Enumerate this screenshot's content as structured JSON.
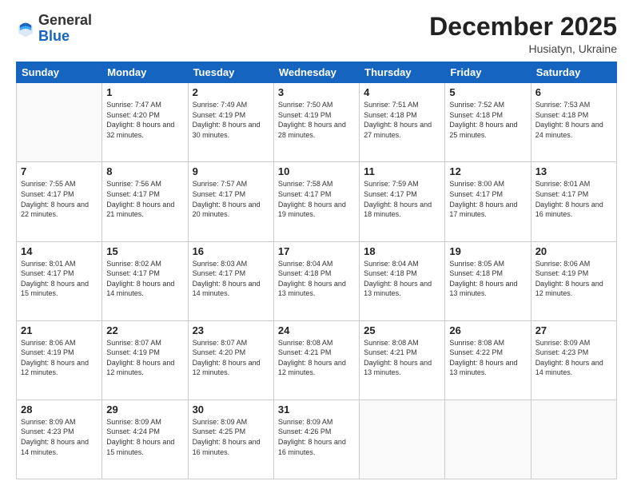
{
  "header": {
    "logo_general": "General",
    "logo_blue": "Blue",
    "month_title": "December 2025",
    "subtitle": "Husiatyn, Ukraine"
  },
  "weekdays": [
    "Sunday",
    "Monday",
    "Tuesday",
    "Wednesday",
    "Thursday",
    "Friday",
    "Saturday"
  ],
  "weeks": [
    [
      {
        "day": "",
        "empty": true
      },
      {
        "day": "1",
        "sunrise": "7:47 AM",
        "sunset": "4:20 PM",
        "daylight": "8 hours and 32 minutes."
      },
      {
        "day": "2",
        "sunrise": "7:49 AM",
        "sunset": "4:19 PM",
        "daylight": "8 hours and 30 minutes."
      },
      {
        "day": "3",
        "sunrise": "7:50 AM",
        "sunset": "4:19 PM",
        "daylight": "8 hours and 28 minutes."
      },
      {
        "day": "4",
        "sunrise": "7:51 AM",
        "sunset": "4:18 PM",
        "daylight": "8 hours and 27 minutes."
      },
      {
        "day": "5",
        "sunrise": "7:52 AM",
        "sunset": "4:18 PM",
        "daylight": "8 hours and 25 minutes."
      },
      {
        "day": "6",
        "sunrise": "7:53 AM",
        "sunset": "4:18 PM",
        "daylight": "8 hours and 24 minutes."
      }
    ],
    [
      {
        "day": "7",
        "sunrise": "7:55 AM",
        "sunset": "4:17 PM",
        "daylight": "8 hours and 22 minutes."
      },
      {
        "day": "8",
        "sunrise": "7:56 AM",
        "sunset": "4:17 PM",
        "daylight": "8 hours and 21 minutes."
      },
      {
        "day": "9",
        "sunrise": "7:57 AM",
        "sunset": "4:17 PM",
        "daylight": "8 hours and 20 minutes."
      },
      {
        "day": "10",
        "sunrise": "7:58 AM",
        "sunset": "4:17 PM",
        "daylight": "8 hours and 19 minutes."
      },
      {
        "day": "11",
        "sunrise": "7:59 AM",
        "sunset": "4:17 PM",
        "daylight": "8 hours and 18 minutes."
      },
      {
        "day": "12",
        "sunrise": "8:00 AM",
        "sunset": "4:17 PM",
        "daylight": "8 hours and 17 minutes."
      },
      {
        "day": "13",
        "sunrise": "8:01 AM",
        "sunset": "4:17 PM",
        "daylight": "8 hours and 16 minutes."
      }
    ],
    [
      {
        "day": "14",
        "sunrise": "8:01 AM",
        "sunset": "4:17 PM",
        "daylight": "8 hours and 15 minutes."
      },
      {
        "day": "15",
        "sunrise": "8:02 AM",
        "sunset": "4:17 PM",
        "daylight": "8 hours and 14 minutes."
      },
      {
        "day": "16",
        "sunrise": "8:03 AM",
        "sunset": "4:17 PM",
        "daylight": "8 hours and 14 minutes."
      },
      {
        "day": "17",
        "sunrise": "8:04 AM",
        "sunset": "4:18 PM",
        "daylight": "8 hours and 13 minutes."
      },
      {
        "day": "18",
        "sunrise": "8:04 AM",
        "sunset": "4:18 PM",
        "daylight": "8 hours and 13 minutes."
      },
      {
        "day": "19",
        "sunrise": "8:05 AM",
        "sunset": "4:18 PM",
        "daylight": "8 hours and 13 minutes."
      },
      {
        "day": "20",
        "sunrise": "8:06 AM",
        "sunset": "4:19 PM",
        "daylight": "8 hours and 12 minutes."
      }
    ],
    [
      {
        "day": "21",
        "sunrise": "8:06 AM",
        "sunset": "4:19 PM",
        "daylight": "8 hours and 12 minutes."
      },
      {
        "day": "22",
        "sunrise": "8:07 AM",
        "sunset": "4:19 PM",
        "daylight": "8 hours and 12 minutes."
      },
      {
        "day": "23",
        "sunrise": "8:07 AM",
        "sunset": "4:20 PM",
        "daylight": "8 hours and 12 minutes."
      },
      {
        "day": "24",
        "sunrise": "8:08 AM",
        "sunset": "4:21 PM",
        "daylight": "8 hours and 12 minutes."
      },
      {
        "day": "25",
        "sunrise": "8:08 AM",
        "sunset": "4:21 PM",
        "daylight": "8 hours and 13 minutes."
      },
      {
        "day": "26",
        "sunrise": "8:08 AM",
        "sunset": "4:22 PM",
        "daylight": "8 hours and 13 minutes."
      },
      {
        "day": "27",
        "sunrise": "8:09 AM",
        "sunset": "4:23 PM",
        "daylight": "8 hours and 14 minutes."
      }
    ],
    [
      {
        "day": "28",
        "sunrise": "8:09 AM",
        "sunset": "4:23 PM",
        "daylight": "8 hours and 14 minutes."
      },
      {
        "day": "29",
        "sunrise": "8:09 AM",
        "sunset": "4:24 PM",
        "daylight": "8 hours and 15 minutes."
      },
      {
        "day": "30",
        "sunrise": "8:09 AM",
        "sunset": "4:25 PM",
        "daylight": "8 hours and 16 minutes."
      },
      {
        "day": "31",
        "sunrise": "8:09 AM",
        "sunset": "4:26 PM",
        "daylight": "8 hours and 16 minutes."
      },
      {
        "day": "",
        "empty": true
      },
      {
        "day": "",
        "empty": true
      },
      {
        "day": "",
        "empty": true
      }
    ]
  ]
}
